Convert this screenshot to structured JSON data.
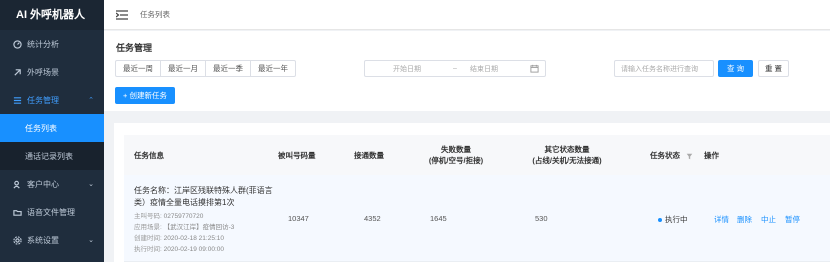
{
  "app": {
    "title": "AI 外呼机器人"
  },
  "sidebar": {
    "items": [
      {
        "label": "统计分析",
        "icon": "dashboard-icon"
      },
      {
        "label": "外呼场景",
        "icon": "scene-icon"
      },
      {
        "label": "任务管理",
        "icon": "task-icon",
        "arrow": "⌃"
      },
      {
        "label": "客户中心",
        "icon": "customer-icon",
        "arrow": "⌄"
      },
      {
        "label": "语音文件管理",
        "icon": "folder-icon"
      },
      {
        "label": "系统设置",
        "icon": "settings-icon",
        "arrow": "⌄"
      }
    ],
    "sub": [
      {
        "label": "任务列表"
      },
      {
        "label": "通话记录列表"
      }
    ]
  },
  "topbar": {
    "breadcrumb": "任务列表"
  },
  "panel": {
    "title": "任务管理",
    "ranges": [
      "最近一周",
      "最近一月",
      "最近一季",
      "最近一年"
    ],
    "date_start": "开始日期",
    "date_sep": "–",
    "date_end": "结束日期",
    "search_placeholder": "请输入任务名称进行查询",
    "query_label": "查 询",
    "reset_label": "重 置",
    "create_label": "+ 创建新任务"
  },
  "table": {
    "headers": {
      "info": "任务信息",
      "called": "被叫号码量",
      "connected": "接通数量",
      "failed_l1": "失败数量",
      "failed_l2": "(停机/空号/拒接)",
      "other_l1": "其它状态数量",
      "other_l2": "(占线/关机/无法接通)",
      "status": "任务状态",
      "ops": "操作"
    },
    "rows": [
      {
        "name_label": "任务名称：",
        "name": "江岸区残联特殊人群(菲语言类）疫情全量电话摸排第1次",
        "caller_label": "主叫号码:",
        "caller": "02759770720",
        "scene_label": "应用场景:",
        "scene": "【武汉江岸】疫情回访-3",
        "created_label": "创建时间:",
        "created": "2020-02-18 21:25:10",
        "exec_label": "执行时间:",
        "exec": "2020-02-19 09:00:00",
        "called": "10347",
        "connected": "4352",
        "failed": "1645",
        "other": "530",
        "status": "执行中",
        "ops": [
          "详情",
          "删除",
          "中止",
          "暂停"
        ]
      }
    ]
  },
  "colors": {
    "sidebar_bg": "#1f2d3d",
    "accent": "#1890ff"
  }
}
